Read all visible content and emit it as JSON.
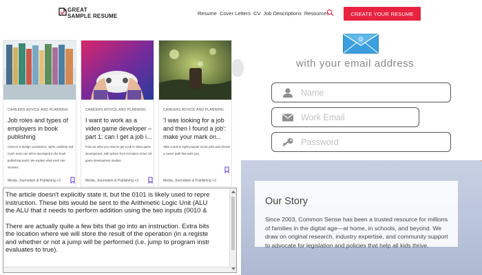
{
  "header": {
    "logo_line1": "GREAT",
    "logo_line2": "SAMPLE RESUME",
    "nav": [
      "Resume",
      "Cover Letters",
      "CV",
      "Job Descriptions",
      "Resources"
    ],
    "cta_label": "CREATE YOUR RESUME",
    "brand_color": "#e8233f"
  },
  "cards": [
    {
      "category": "CAREERS ADVICE AND PLANNING",
      "title": "Job roles and types of employers in book publishing",
      "description": "Careers in design, production, rights, publicity and much more can all be developed in the book publishing world. We explain what each role involves.",
      "tags": "Media, Journalism & Publishing +3",
      "image": "books-photo"
    },
    {
      "category": "CAREERS ADVICE AND PLANNING",
      "title": "I want to work as a video game developer – part 1: can I get a job i...",
      "description": "Find out what you need to get a job in video game development, with advice from recruiters at two UK game development studios.",
      "tags": "Media, Journalism & Publishing +3",
      "image": "game-controller-photo"
    },
    {
      "category": "CAREERS ADVICE AND PLANNING",
      "title": "'I was looking for a job and then I found a job': make your mark on...",
      "description": "Take a look at eight popular music jobs and choose a career path that suits you.",
      "tags": "Media, Journalism & Publishing +3",
      "image": "music-photo"
    }
  ],
  "article": {
    "paragraphs": [
      [
        "The article doesn't explicitly state it, but the 0101 is likely used to repre",
        "instruction. These bits would be sent to the Arithmetic Logic Unit (ALU",
        "the ALU that it needs to perform addition using the two inputs (0010 &"
      ],
      [
        "There are actually quite a few bits that go into an instruction. Extra bits",
        "the location where we will store the result of the operation (in a registe",
        "and whether or not a jump will be performed (i.e. jump to program instr",
        "evaluates to true)."
      ]
    ]
  },
  "signup": {
    "heading": "with your email address",
    "name_placeholder": "Name",
    "email_placeholder": "Work Email",
    "password_placeholder": "Password"
  },
  "story": {
    "title": "Our Story",
    "text": "Since 2003, Common Sense has been a trusted resource for millions of families in the digital age—at home, in schools, and beyond. We draw on original research, industry expertise, and community support to advocate for legislation and policies that help all kids thrive."
  }
}
